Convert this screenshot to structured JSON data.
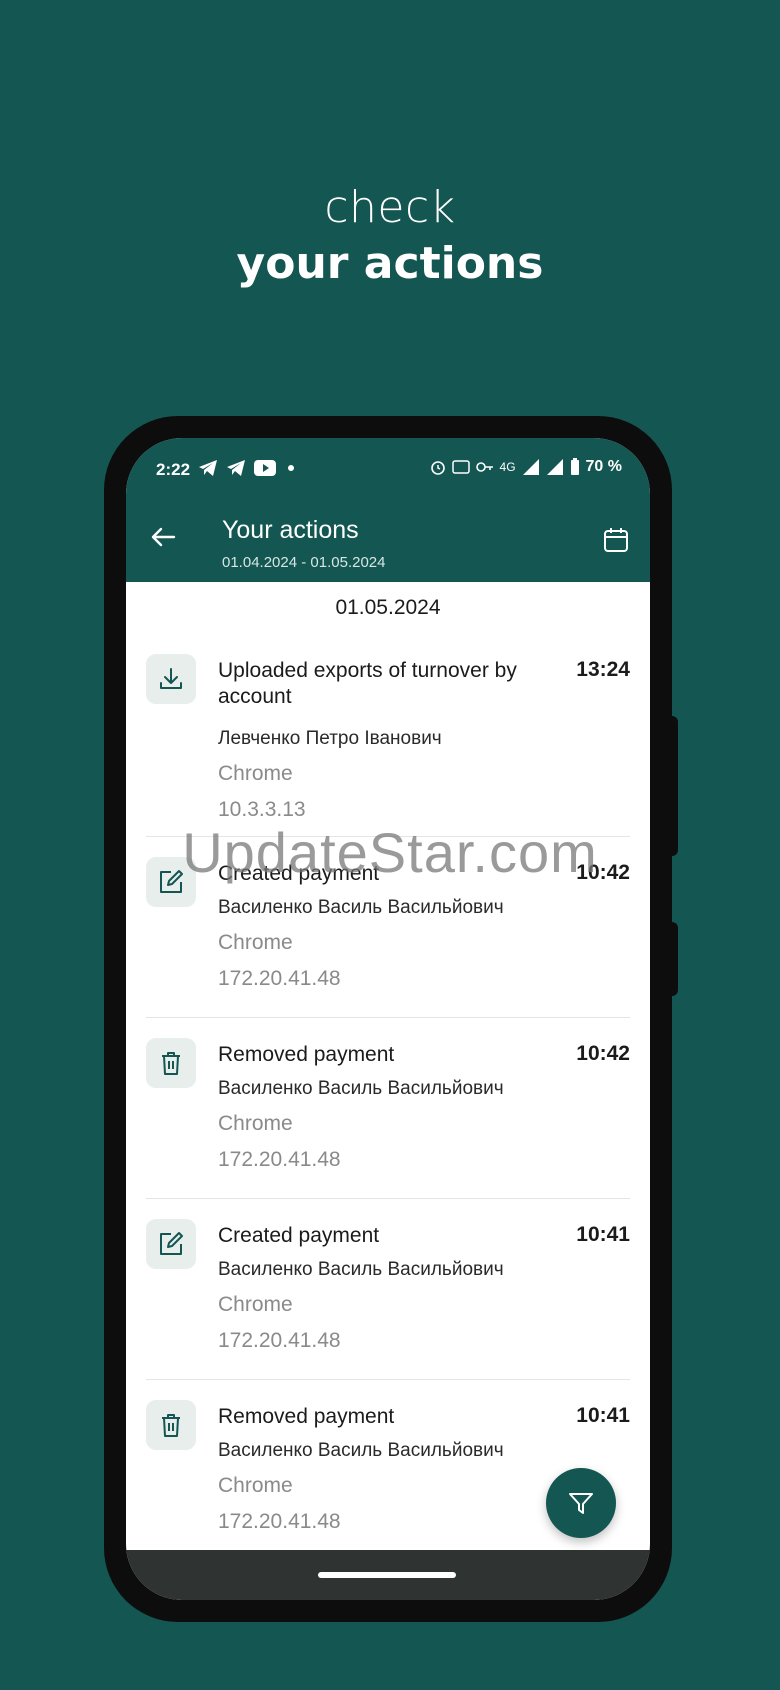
{
  "headline": {
    "line1": "check",
    "line2": "your actions"
  },
  "status_bar": {
    "time": "2:22",
    "battery": "70 %",
    "network": "4G"
  },
  "app_bar": {
    "title": "Your actions",
    "date_range": "01.04.2024 - 01.05.2024",
    "back_icon": "arrow-left-icon",
    "calendar_icon": "calendar-icon"
  },
  "date_header": "01.05.2024",
  "actions": [
    {
      "icon": "download-icon",
      "title": "Uploaded exports of turnover by account",
      "time": "13:24",
      "user": "Левченко Петро Іванович",
      "browser": "Chrome",
      "ip": "10.3.3.13"
    },
    {
      "icon": "edit-icon",
      "title": "Created payment",
      "time": "10:42",
      "user": "Василенко Василь Васильйович",
      "browser": "Chrome",
      "ip": "172.20.41.48"
    },
    {
      "icon": "trash-icon",
      "title": "Removed payment",
      "time": "10:42",
      "user": "Василенко Василь Васильйович",
      "browser": "Chrome",
      "ip": "172.20.41.48"
    },
    {
      "icon": "edit-icon",
      "title": "Created payment",
      "time": "10:41",
      "user": "Василенко Василь Васильйович",
      "browser": "Chrome",
      "ip": "172.20.41.48"
    },
    {
      "icon": "trash-icon",
      "title": "Removed payment",
      "time": "10:41",
      "user": "Василенко Василь Васильйович",
      "browser": "Chrome",
      "ip": "172.20.41.48"
    }
  ],
  "fab_icon": "filter-icon",
  "watermark": "UpdateStar.com",
  "colors": {
    "brand": "#135652",
    "icon_bg": "#e7eeec",
    "muted_text": "#8a8a8a"
  }
}
